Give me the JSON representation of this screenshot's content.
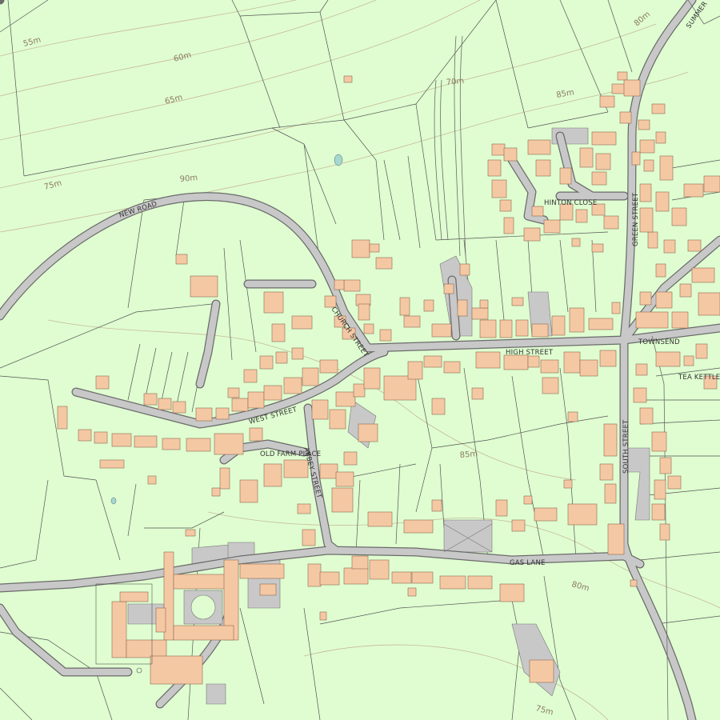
{
  "map": {
    "background_color": "#dffdd0",
    "building_color": "#f5c8a4",
    "road_color": "#c8c8c8",
    "contour_color": "#c9b99a",
    "field_boundary_color": "#555555",
    "water_color": "#a6d8d0"
  },
  "road_labels": {
    "new_road": "NEW ROAD",
    "church_street": "CHURCH STREET",
    "high_street": "HIGH STREET",
    "townsend": "TOWNSEND",
    "tea_kettle": "TEA KETTLE",
    "west_street": "WEST STREET",
    "old_farm_place": "OLD FARM PLACE",
    "abbey_street": "ABBEY STREET",
    "south_street": "SOUTH STREET",
    "gas_lane": "GAS LANE",
    "hinton_close": "HINTON CLOSE",
    "green_street": "GREEN STREET",
    "summer": "SUMMER"
  },
  "contour_labels": {
    "c55": "55m",
    "c60": "60m",
    "c65": "65m",
    "c70": "70m",
    "c75_west": "75m",
    "c80_ne": "80m",
    "c85_north": "85m",
    "c90": "90m",
    "c85_south": "85m",
    "c80_se": "80m",
    "c75_south": "75m"
  }
}
